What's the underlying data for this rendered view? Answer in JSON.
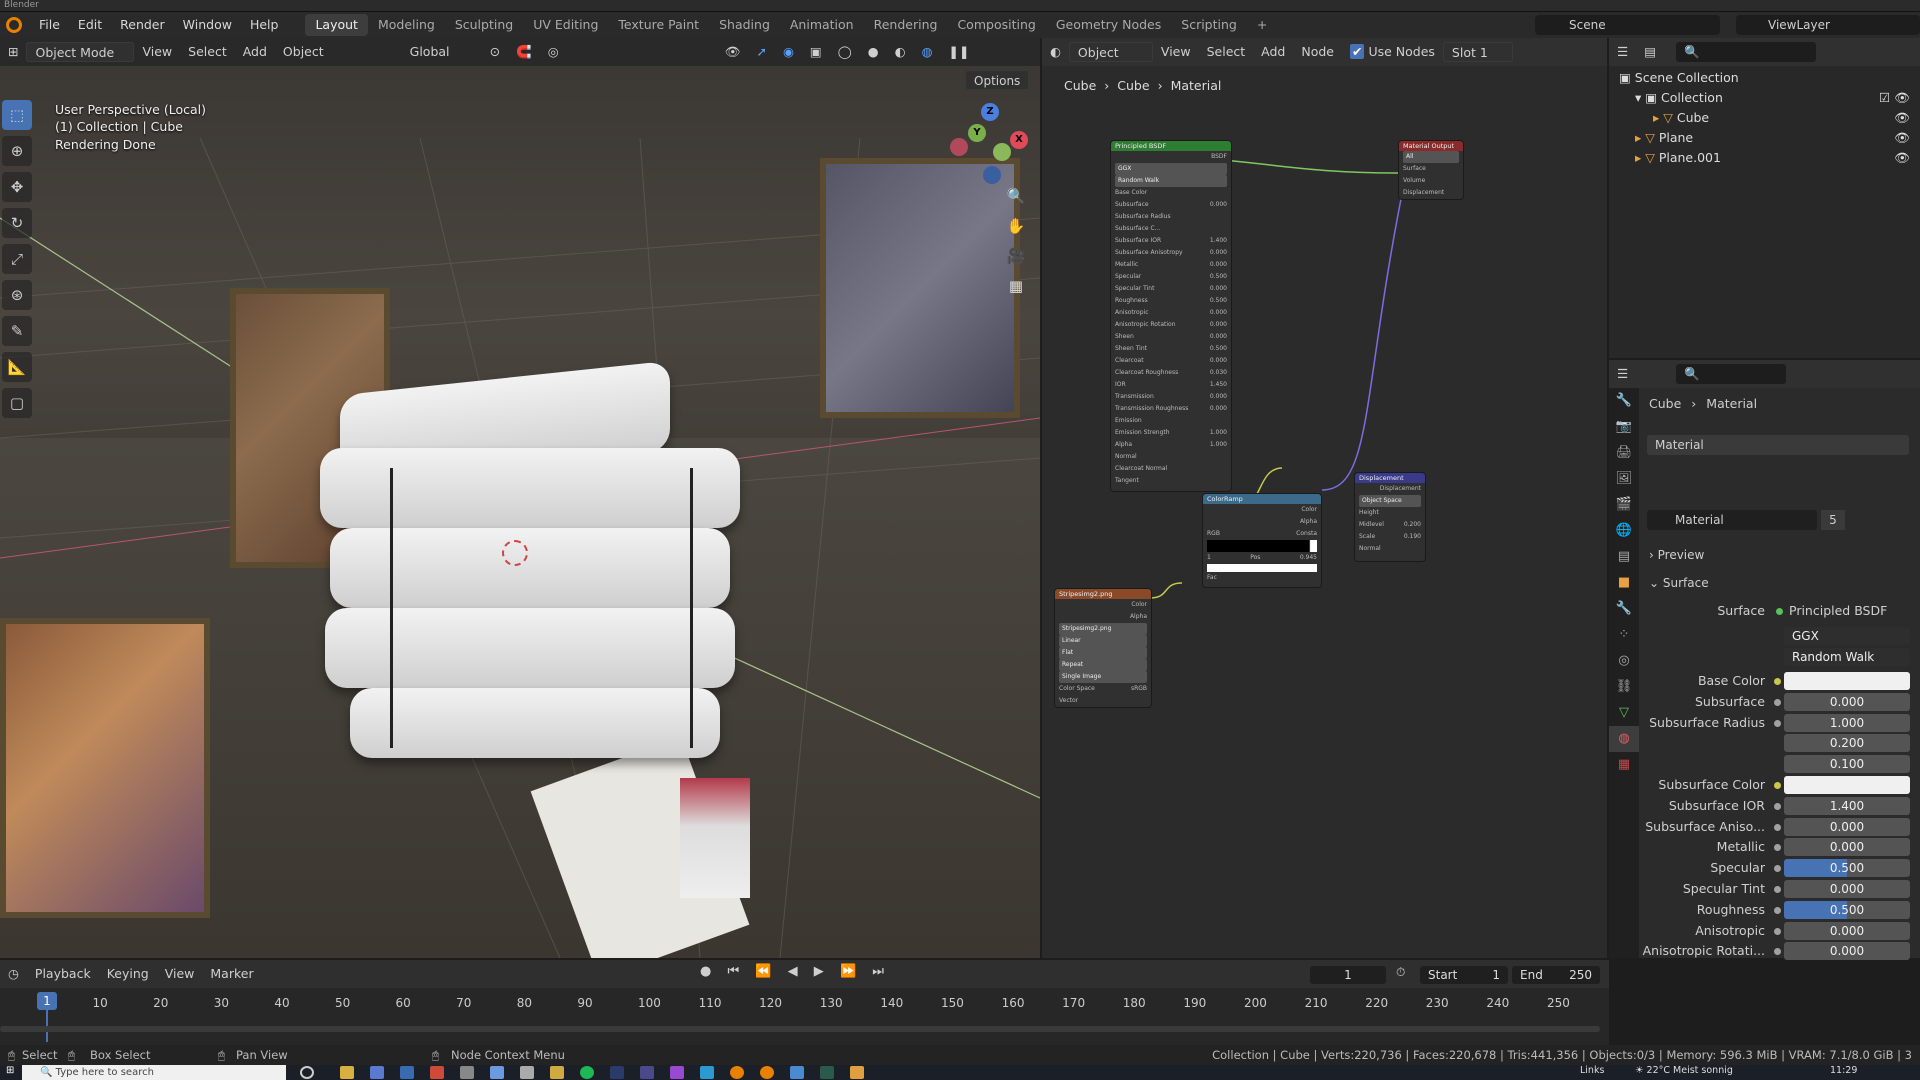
{
  "app": {
    "title": "Blender"
  },
  "menu": {
    "items": [
      "File",
      "Edit",
      "Render",
      "Window",
      "Help"
    ],
    "workspaces": [
      "Layout",
      "Modeling",
      "Sculpting",
      "UV Editing",
      "Texture Paint",
      "Shading",
      "Animation",
      "Rendering",
      "Compositing",
      "Geometry Nodes",
      "Scripting"
    ],
    "active_workspace": "Layout",
    "add_tab": "+",
    "scene": "Scene",
    "view_layer": "ViewLayer"
  },
  "viewport": {
    "mode": "Object Mode",
    "menus": [
      "View",
      "Select",
      "Add",
      "Object"
    ],
    "transform": "Global",
    "options": "Options",
    "overlay_lines": [
      "User Perspective (Local)",
      "(1) Collection | Cube",
      "Rendering Done"
    ],
    "gizmo": {
      "x": "X",
      "y": "Y",
      "z": "Z"
    }
  },
  "node_editor": {
    "object_mode": "Object",
    "menus": [
      "View",
      "Select",
      "Add",
      "Node"
    ],
    "use_nodes": "Use Nodes",
    "slot": "Slot 1",
    "breadcrumb": [
      "Cube",
      "Cube",
      "Material"
    ],
    "nodes": {
      "bsdf": {
        "title": "Principled BSDF",
        "out": "BSDF",
        "dist": "GGX",
        "sss": "Random Walk",
        "rows": [
          [
            "Base Color",
            ""
          ],
          [
            "Subsurface",
            "0.000"
          ],
          [
            "Subsurface Radius",
            ""
          ],
          [
            "Subsurface C...",
            ""
          ],
          [
            "Subsurface IOR",
            "1.400"
          ],
          [
            "Subsurface Anisotropy",
            "0.000"
          ],
          [
            "Metallic",
            "0.000"
          ],
          [
            "Specular",
            "0.500"
          ],
          [
            "Specular Tint",
            "0.000"
          ],
          [
            "Roughness",
            "0.500"
          ],
          [
            "Anisotropic",
            "0.000"
          ],
          [
            "Anisotropic Rotation",
            "0.000"
          ],
          [
            "Sheen",
            "0.000"
          ],
          [
            "Sheen Tint",
            "0.500"
          ],
          [
            "Clearcoat",
            "0.000"
          ],
          [
            "Clearcoat Roughness",
            "0.030"
          ],
          [
            "IOR",
            "1.450"
          ],
          [
            "Transmission",
            "0.000"
          ],
          [
            "Transmission Roughness",
            "0.000"
          ],
          [
            "Emission",
            ""
          ],
          [
            "Emission Strength",
            "1.000"
          ],
          [
            "Alpha",
            "1.000"
          ],
          [
            "Normal",
            ""
          ],
          [
            "Clearcoat Normal",
            ""
          ],
          [
            "Tangent",
            ""
          ]
        ]
      },
      "output": {
        "title": "Material Output",
        "target": "All",
        "rows": [
          "Surface",
          "Volume",
          "Displacement"
        ]
      },
      "ramp": {
        "title": "ColorRamp",
        "outs": [
          "Color",
          "Alpha"
        ],
        "mode": "RGB",
        "interp": "Consta",
        "pos_label": "Pos",
        "pos": "0.945",
        "index": "1",
        "fac": "Fac"
      },
      "disp": {
        "title": "Displacement",
        "out": "Displacement",
        "space": "Object Space",
        "rows": [
          [
            "Height",
            ""
          ],
          [
            "Midlevel",
            "0.200"
          ],
          [
            "Scale",
            "0.190"
          ],
          [
            "Normal",
            ""
          ]
        ]
      },
      "image": {
        "title": "Stripesimg2.png",
        "outs": [
          "Color",
          "Alpha"
        ],
        "file": "Stripesimg2.png",
        "rows": [
          "Linear",
          "Flat",
          "Repeat",
          "Single Image",
          "Color Space",
          "Vector"
        ],
        "colorspace": "sRGB"
      }
    }
  },
  "outliner": {
    "root": "Scene Collection",
    "collection": "Collection",
    "items": [
      "Cube",
      "Plane",
      "Plane.001"
    ]
  },
  "properties": {
    "breadcrumb": [
      "Cube",
      "Material"
    ],
    "slot_name": "Material",
    "material_name": "Material",
    "users": "5",
    "preview": "Preview",
    "surface_section": "Surface",
    "surface_label": "Surface",
    "surface_shader": "Principled BSDF",
    "distribution": "GGX",
    "subsurface_method": "Random Walk",
    "fields": [
      {
        "label": "Base Color",
        "value": "",
        "type": "color"
      },
      {
        "label": "Subsurface",
        "value": "0.000"
      },
      {
        "label": "Subsurface Radius",
        "value": "1.000"
      },
      {
        "label": "",
        "value": "0.200"
      },
      {
        "label": "",
        "value": "0.100"
      },
      {
        "label": "Subsurface Color",
        "value": "",
        "type": "color"
      },
      {
        "label": "Subsurface IOR",
        "value": "1.400"
      },
      {
        "label": "Subsurface Aniso...",
        "value": "0.000"
      },
      {
        "label": "Metallic",
        "value": "0.000"
      },
      {
        "label": "Specular",
        "value": "0.500",
        "fill": 0.5
      },
      {
        "label": "Specular Tint",
        "value": "0.000"
      },
      {
        "label": "Roughness",
        "value": "0.500",
        "fill": 0.5
      },
      {
        "label": "Anisotropic",
        "value": "0.000"
      },
      {
        "label": "Anisotropic Rotati...",
        "value": "0.000"
      }
    ]
  },
  "timeline": {
    "menus": [
      "Playback",
      "Keying",
      "View",
      "Marker"
    ],
    "current_frame": "1",
    "start_label": "Start",
    "start": "1",
    "end_label": "End",
    "end": "250",
    "ticks": [
      "10",
      "20",
      "30",
      "40",
      "50",
      "60",
      "70",
      "80",
      "90",
      "100",
      "110",
      "120",
      "130",
      "140",
      "150",
      "160",
      "170",
      "180",
      "190",
      "200",
      "210",
      "220",
      "230",
      "240",
      "250"
    ]
  },
  "status": {
    "select": "Select",
    "box_select": "Box Select",
    "pan_view": "Pan View",
    "context_menu": "Node Context Menu",
    "stats": "Collection | Cube | Verts:220,736 | Faces:220,678 | Tris:441,356 | Objects:0/3 | Memory: 596.3 MiB | VRAM: 7.1/8.0 GiB | 3"
  },
  "taskbar": {
    "search_placeholder": "Type here to search",
    "weather": "22°C  Meist sonnig",
    "links": "Links",
    "time": "11:29"
  }
}
